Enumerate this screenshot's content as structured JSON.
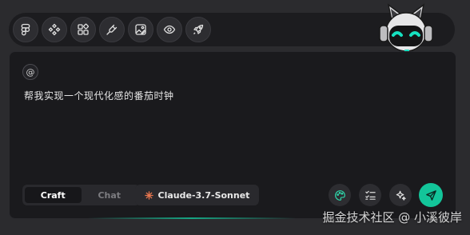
{
  "toolbar": {
    "tools": [
      {
        "icon": "figma-icon"
      },
      {
        "icon": "component-icon"
      },
      {
        "icon": "apps-grid-icon"
      },
      {
        "icon": "plug-icon"
      },
      {
        "icon": "image-edit-icon"
      },
      {
        "icon": "eye-icon"
      },
      {
        "icon": "rocket-icon"
      }
    ]
  },
  "composer": {
    "mention_symbol": "@",
    "prompt_text": "帮我实现一个现代化感的番茄时钟",
    "modes": {
      "craft": "Craft",
      "chat": "Chat",
      "active": "Craft"
    },
    "model": {
      "label": "Claude-3.7-Sonnet",
      "icon": "claude-sparkle-icon"
    },
    "actions": [
      {
        "icon": "palette-icon"
      },
      {
        "icon": "checklist-icon"
      },
      {
        "icon": "magic-sparkles-icon"
      },
      {
        "icon": "send-icon"
      }
    ]
  },
  "watermark": "掘金技术社区 @ 小溪彼岸",
  "colors": {
    "accent": "#13c59a",
    "background": "#2b2b2e",
    "panel": "#1a1a1d",
    "claude": "#e8764f"
  }
}
